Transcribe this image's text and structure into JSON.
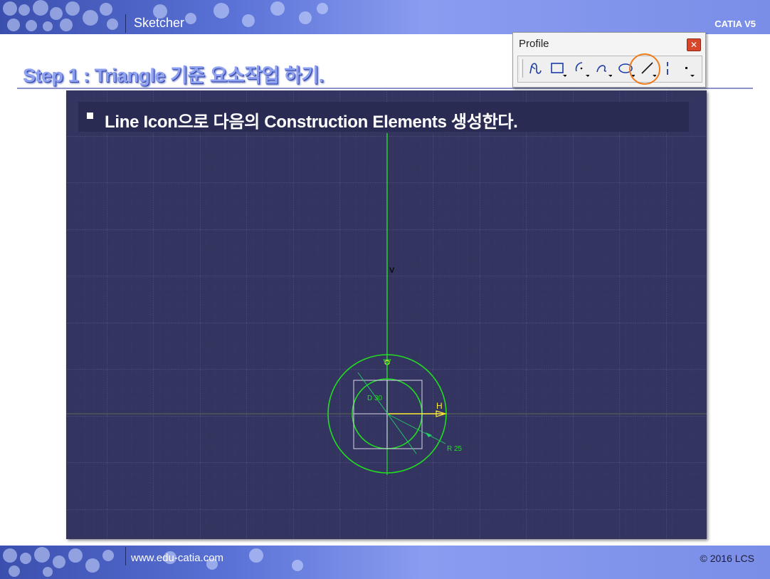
{
  "header": {
    "title": "Sketcher",
    "brand": "CATIA V5"
  },
  "step": {
    "title": "Step 1 : Triangle 기준 요소작업 하기."
  },
  "caption": {
    "text": "Line Icon으로 다음의 Construction Elements 생성한다."
  },
  "toolbar": {
    "title": "Profile",
    "close_label": "✕",
    "tools": [
      "profile-icon",
      "rectangle-icon",
      "arc-icon",
      "spline-icon",
      "ellipse-icon",
      "line-icon",
      "axis-icon",
      "point-icon"
    ],
    "highlighted_tool": "line-icon",
    "highlight_color": "#f07a1a"
  },
  "sketch": {
    "v_axis_label": "V",
    "h_axis_label": "H",
    "diameter_label": "D 30",
    "radius_label": "R 25",
    "circle_color": "#22dd22",
    "axis_color": "#ffee33",
    "grid_color": "#4a4c7a"
  },
  "footer": {
    "url": "www.edu-catia.com",
    "copyright": "© 2016 LCS"
  }
}
